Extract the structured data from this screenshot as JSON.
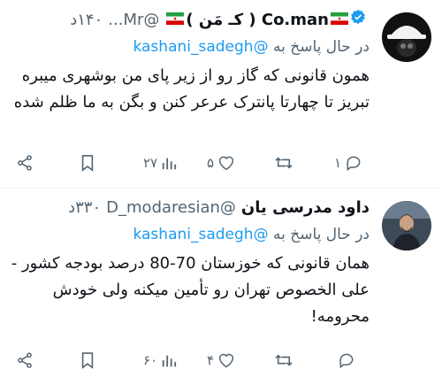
{
  "tweets": [
    {
      "display_name": "Co.man ( کـ مَن )",
      "handle": "@Mr...",
      "time": "۱۴۰د",
      "replying_prefix": "در حال پاسخ به",
      "replying_to": "@kashani_sadegh",
      "text": "همون قانونی که گاز رو از زیر پای من بوشهری میبره تبریز تا چهارتا پانترک عرعر کنن و بگن به ما ظلم شده",
      "actions": {
        "replies": "۱",
        "retweets": "",
        "likes": "۵",
        "views": "۲۷"
      },
      "avatar_icon": "pith-helmet-skull-avatar"
    },
    {
      "display_name": "داود مدرسی یان",
      "handle": "@D_modaresian",
      "time": "۳۳۰د",
      "replying_prefix": "در حال پاسخ به",
      "replying_to": "@kashani_sadegh",
      "text": "همان قانونی که خوزستان 70-80 درصد بودجه کشور - علی الخصوص تهران رو تأمین میکنه ولی خودش محرومه!",
      "actions": {
        "replies": "",
        "retweets": "",
        "likes": "۴",
        "views": "۶۰"
      },
      "avatar_icon": "man-portrait-avatar"
    }
  ],
  "colors": {
    "link": "#1d9bf0",
    "muted": "#536471",
    "text": "#0f1419",
    "divider": "#eff3f4"
  }
}
